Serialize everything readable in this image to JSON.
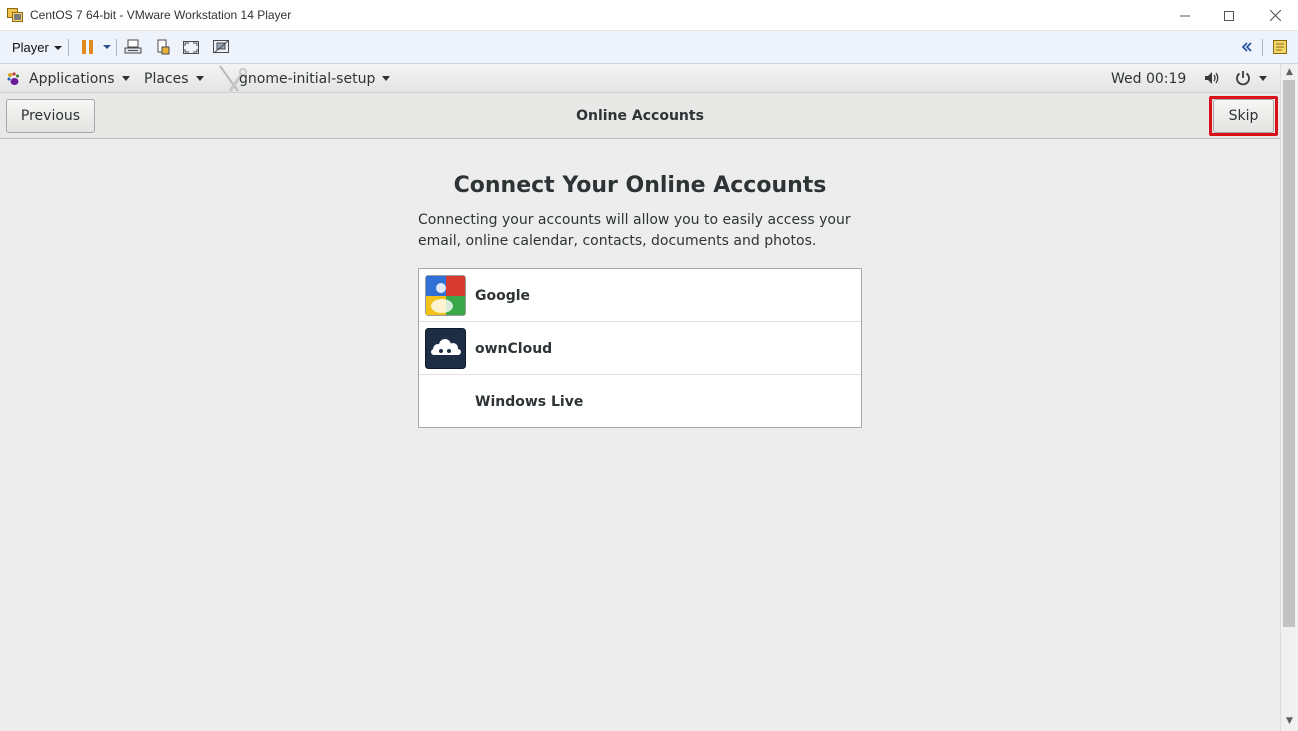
{
  "window": {
    "title": "CentOS 7 64-bit - VMware Workstation 14 Player",
    "controls": {
      "minimize": "—",
      "maximize": "☐",
      "close": "✕"
    }
  },
  "player_toolbar": {
    "menu_label": "Player",
    "icons": [
      "pause-icon",
      "send-ctrl-alt-del-icon",
      "removable-devices-icon",
      "fullscreen-icon",
      "unity-icon",
      "collapse-toolbar-icon",
      "message-log-icon"
    ],
    "pause_color": "#e08a1e"
  },
  "gnome_topbar": {
    "applications_label": "Applications",
    "places_label": "Places",
    "active_app_label": "gnome-initial-setup",
    "clock": "Wed 00:19",
    "status_icons": [
      "volume-icon",
      "power-icon"
    ]
  },
  "header": {
    "previous_label": "Previous",
    "title": "Online Accounts",
    "skip_label": "Skip",
    "highlight_color": "#d8101a"
  },
  "main": {
    "heading": "Connect Your Online Accounts",
    "description": "Connecting your accounts will allow you to easily access your email, online calendar, contacts, documents and photos.",
    "providers": [
      {
        "name": "Google",
        "icon": "google-icon"
      },
      {
        "name": "ownCloud",
        "icon": "owncloud-icon"
      },
      {
        "name": "Windows Live",
        "icon": ""
      }
    ]
  }
}
